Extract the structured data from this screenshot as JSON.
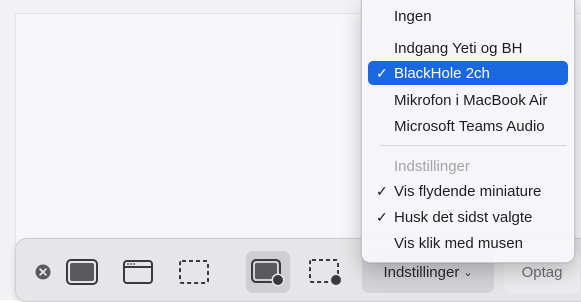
{
  "microphone_menu": {
    "items": [
      {
        "label": "Ingen",
        "checked": false
      },
      {
        "label": "Indgang Yeti og BH",
        "checked": false
      },
      {
        "label": "BlackHole 2ch",
        "checked": true,
        "highlighted": true
      },
      {
        "label": "Mikrofon i MacBook Air",
        "checked": false
      },
      {
        "label": "Microsoft Teams Audio",
        "checked": false
      }
    ]
  },
  "options_menu": {
    "header": "Indstillinger",
    "items": [
      {
        "label": "Vis flydende miniature",
        "checked": true
      },
      {
        "label": "Husk det sidst valgte",
        "checked": true
      },
      {
        "label": "Vis klik med musen",
        "checked": false
      }
    ]
  },
  "check_glyph": "✓",
  "toolbar": {
    "options_label": "Indstillinger",
    "capture_label": "Optag"
  },
  "colors": {
    "highlight": "#1a67e0",
    "toolbar_bg": "#e6e6e8"
  }
}
